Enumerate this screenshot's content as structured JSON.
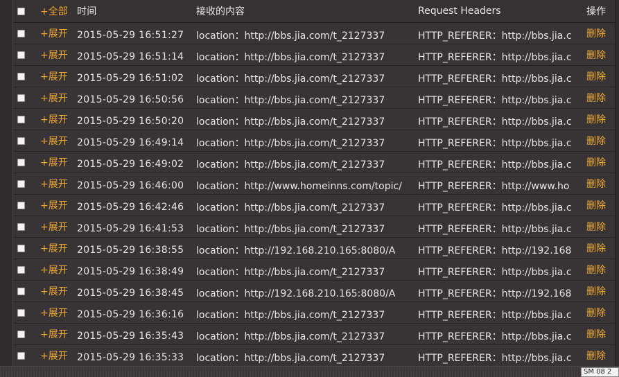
{
  "header": {
    "expand_all": "+全部",
    "time": "时间",
    "content": "接收的内容",
    "request_headers": "Request Headers",
    "action": "操作"
  },
  "rows": [
    {
      "expand": "+展开",
      "time": "2015-05-29 16:51:27",
      "content": "location：http://bbs.jia.com/t_2127337",
      "headers": "HTTP_REFERER：http://bbs.jia.c",
      "action": "删除"
    },
    {
      "expand": "+展开",
      "time": "2015-05-29 16:51:14",
      "content": "location：http://bbs.jia.com/t_2127337",
      "headers": "HTTP_REFERER：http://bbs.jia.c",
      "action": "删除"
    },
    {
      "expand": "+展开",
      "time": "2015-05-29 16:51:02",
      "content": "location：http://bbs.jia.com/t_2127337",
      "headers": "HTTP_REFERER：http://bbs.jia.c",
      "action": "删除"
    },
    {
      "expand": "+展开",
      "time": "2015-05-29 16:50:56",
      "content": "location：http://bbs.jia.com/t_2127337",
      "headers": "HTTP_REFERER：http://bbs.jia.c",
      "action": "删除"
    },
    {
      "expand": "+展开",
      "time": "2015-05-29 16:50:20",
      "content": "location：http://bbs.jia.com/t_2127337",
      "headers": "HTTP_REFERER：http://bbs.jia.c",
      "action": "删除"
    },
    {
      "expand": "+展开",
      "time": "2015-05-29 16:49:14",
      "content": "location：http://bbs.jia.com/t_2127337",
      "headers": "HTTP_REFERER：http://bbs.jia.c",
      "action": "删除"
    },
    {
      "expand": "+展开",
      "time": "2015-05-29 16:49:02",
      "content": "location：http://bbs.jia.com/t_2127337",
      "headers": "HTTP_REFERER：http://bbs.jia.c",
      "action": "删除"
    },
    {
      "expand": "+展开",
      "time": "2015-05-29 16:46:00",
      "content": "location：http://www.homeinns.com/topic/",
      "headers": "HTTP_REFERER：http://www.ho",
      "action": "删除"
    },
    {
      "expand": "+展开",
      "time": "2015-05-29 16:42:46",
      "content": "location：http://bbs.jia.com/t_2127337",
      "headers": "HTTP_REFERER：http://bbs.jia.c",
      "action": "删除"
    },
    {
      "expand": "+展开",
      "time": "2015-05-29 16:41:53",
      "content": "location：http://bbs.jia.com/t_2127337",
      "headers": "HTTP_REFERER：http://bbs.jia.c",
      "action": "删除"
    },
    {
      "expand": "+展开",
      "time": "2015-05-29 16:38:55",
      "content": "location：http://192.168.210.165:8080/A",
      "headers": "HTTP_REFERER：http://192.168",
      "action": "删除"
    },
    {
      "expand": "+展开",
      "time": "2015-05-29 16:38:49",
      "content": "location：http://bbs.jia.com/t_2127337",
      "headers": "HTTP_REFERER：http://bbs.jia.c",
      "action": "删除"
    },
    {
      "expand": "+展开",
      "time": "2015-05-29 16:38:45",
      "content": "location：http://192.168.210.165:8080/A",
      "headers": "HTTP_REFERER：http://192.168",
      "action": "删除"
    },
    {
      "expand": "+展开",
      "time": "2015-05-29 16:36:16",
      "content": "location：http://bbs.jia.com/t_2127337",
      "headers": "HTTP_REFERER：http://bbs.jia.c",
      "action": "删除"
    },
    {
      "expand": "+展开",
      "time": "2015-05-29 16:35:43",
      "content": "location：http://bbs.jia.com/t_2127337",
      "headers": "HTTP_REFERER：http://bbs.jia.c",
      "action": "删除"
    },
    {
      "expand": "+展开",
      "time": "2015-05-29 16:35:33",
      "content": "location：http://bbs.jia.com/t_2127337",
      "headers": "HTTP_REFERER：http://bbs.jia.c",
      "action": "删除"
    }
  ],
  "statusbar": {
    "text": "SM 08 2"
  },
  "colors": {
    "accent": "#f0a830",
    "text": "#e6e6e6",
    "background": "#383436"
  }
}
